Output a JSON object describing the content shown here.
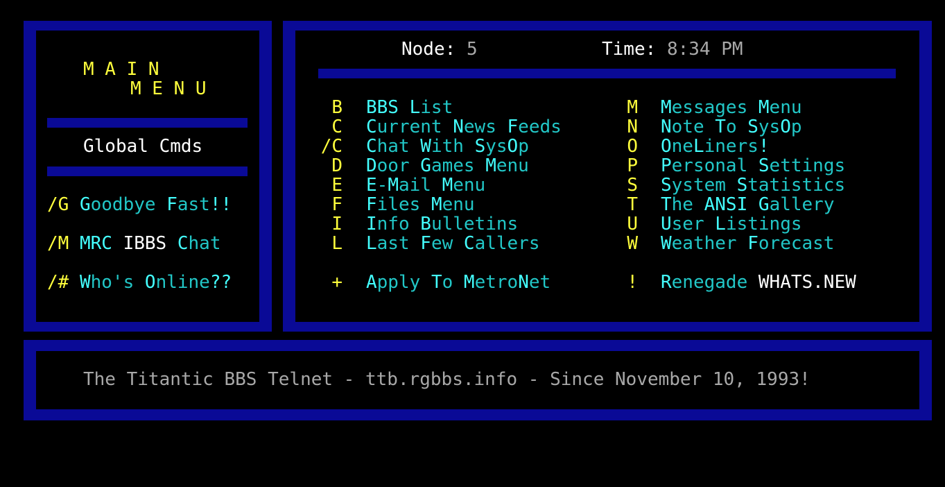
{
  "sidebar": {
    "title_line1": "M A I N",
    "title_line2": "M E N U",
    "global_label": "Global Cmds",
    "commands": [
      {
        "key": "/G",
        "label_hi1": "G",
        "label_lo1": "oodbye ",
        "label_hi2": "F",
        "label_lo2": "ast",
        "label_tail": "!!"
      },
      {
        "key": "/M",
        "label_a": "MRC ",
        "label_b": "IBBS ",
        "label_hi": "C",
        "label_lo": "hat"
      },
      {
        "key": "/#",
        "label_hi1": "W",
        "label_lo1": "ho's ",
        "label_hi2": "O",
        "label_lo2": "nline",
        "label_tail": "??"
      }
    ]
  },
  "header": {
    "node_label": "Node:",
    "node_value": "5",
    "time_label": "Time:",
    "time_value": "8:34 PM"
  },
  "menu_left": [
    {
      "key": "B",
      "parts": [
        [
          "hi",
          "B"
        ],
        [
          "hi",
          "BS "
        ],
        [
          "hi",
          "L"
        ],
        [
          "lo",
          "ist"
        ]
      ]
    },
    {
      "key": "C",
      "parts": [
        [
          "hi",
          "C"
        ],
        [
          "lo",
          "urrent "
        ],
        [
          "hi",
          "N"
        ],
        [
          "lo",
          "ews "
        ],
        [
          "hi",
          "F"
        ],
        [
          "lo",
          "eeds"
        ]
      ]
    },
    {
      "key": "/C",
      "parts": [
        [
          "hi",
          "C"
        ],
        [
          "lo",
          "hat "
        ],
        [
          "hi",
          "W"
        ],
        [
          "lo",
          "ith "
        ],
        [
          "hi",
          "S"
        ],
        [
          "lo",
          "ys"
        ],
        [
          "hi",
          "O"
        ],
        [
          "lo",
          "p"
        ]
      ]
    },
    {
      "key": "D",
      "parts": [
        [
          "hi",
          "D"
        ],
        [
          "lo",
          "oor "
        ],
        [
          "hi",
          "G"
        ],
        [
          "lo",
          "ames "
        ],
        [
          "hi",
          "M"
        ],
        [
          "lo",
          "enu"
        ]
      ]
    },
    {
      "key": "E",
      "parts": [
        [
          "hi",
          "E"
        ],
        [
          "lo",
          "-"
        ],
        [
          "hi",
          "M"
        ],
        [
          "lo",
          "ail "
        ],
        [
          "hi",
          "M"
        ],
        [
          "lo",
          "enu"
        ]
      ]
    },
    {
      "key": "F",
      "parts": [
        [
          "hi",
          "F"
        ],
        [
          "lo",
          "iles "
        ],
        [
          "hi",
          "M"
        ],
        [
          "lo",
          "enu"
        ]
      ]
    },
    {
      "key": "I",
      "parts": [
        [
          "hi",
          "I"
        ],
        [
          "lo",
          "nfo "
        ],
        [
          "hi",
          "B"
        ],
        [
          "lo",
          "ulletins"
        ]
      ]
    },
    {
      "key": "L",
      "parts": [
        [
          "hi",
          "L"
        ],
        [
          "lo",
          "ast "
        ],
        [
          "hi",
          "F"
        ],
        [
          "lo",
          "ew "
        ],
        [
          "hi",
          "C"
        ],
        [
          "lo",
          "allers"
        ]
      ]
    }
  ],
  "menu_right": [
    {
      "key": "M",
      "parts": [
        [
          "hi",
          "M"
        ],
        [
          "lo",
          "essages "
        ],
        [
          "hi",
          "M"
        ],
        [
          "lo",
          "enu"
        ]
      ]
    },
    {
      "key": "N",
      "parts": [
        [
          "hi",
          "N"
        ],
        [
          "lo",
          "ote "
        ],
        [
          "hi",
          "T"
        ],
        [
          "lo",
          "o "
        ],
        [
          "hi",
          "S"
        ],
        [
          "lo",
          "ys"
        ],
        [
          "hi",
          "O"
        ],
        [
          "lo",
          "p"
        ]
      ]
    },
    {
      "key": "O",
      "parts": [
        [
          "hi",
          "O"
        ],
        [
          "lo",
          "ne"
        ],
        [
          "hi",
          "L"
        ],
        [
          "lo",
          "iners"
        ],
        [
          "hi",
          "!"
        ]
      ]
    },
    {
      "key": "P",
      "parts": [
        [
          "hi",
          "P"
        ],
        [
          "lo",
          "ersonal "
        ],
        [
          "hi",
          "S"
        ],
        [
          "lo",
          "ettings"
        ]
      ]
    },
    {
      "key": "S",
      "parts": [
        [
          "hi",
          "S"
        ],
        [
          "lo",
          "ystem "
        ],
        [
          "hi",
          "S"
        ],
        [
          "lo",
          "tatistics"
        ]
      ]
    },
    {
      "key": "T",
      "parts": [
        [
          "hi",
          "T"
        ],
        [
          "lo",
          "he "
        ],
        [
          "hi",
          "ANSI "
        ],
        [
          "hi",
          "G"
        ],
        [
          "lo",
          "allery"
        ]
      ]
    },
    {
      "key": "U",
      "parts": [
        [
          "hi",
          "U"
        ],
        [
          "lo",
          "ser "
        ],
        [
          "hi",
          "L"
        ],
        [
          "lo",
          "istings"
        ]
      ]
    },
    {
      "key": "W",
      "parts": [
        [
          "hi",
          "W"
        ],
        [
          "lo",
          "eather "
        ],
        [
          "hi",
          "F"
        ],
        [
          "lo",
          "orecast"
        ]
      ]
    }
  ],
  "extra_left": {
    "key": "+",
    "parts": [
      [
        "hi",
        "A"
      ],
      [
        "lo",
        "pply "
      ],
      [
        "hi",
        "T"
      ],
      [
        "lo",
        "o "
      ],
      [
        "hi",
        "M"
      ],
      [
        "lo",
        "etro"
      ],
      [
        "hi",
        "N"
      ],
      [
        "lo",
        "et"
      ]
    ]
  },
  "extra_right": {
    "key": "!",
    "parts": [
      [
        "hi",
        "R"
      ],
      [
        "lo",
        "enegade "
      ],
      [
        "wh",
        "WHATS.NEW"
      ]
    ]
  },
  "footer": {
    "text": "The Titantic BBS Telnet - ttb.rgbbs.info - Since November 10, 1993!"
  }
}
